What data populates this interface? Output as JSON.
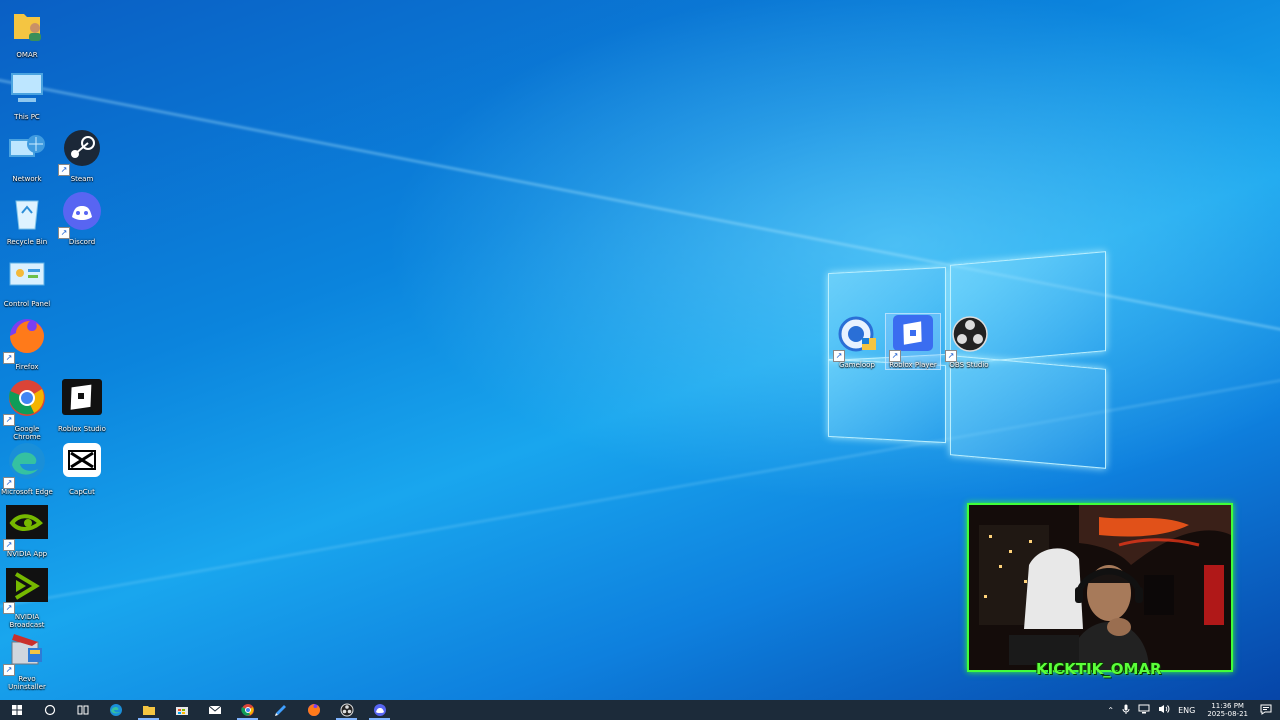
{
  "desktop_icons": [
    {
      "label": "OMAR",
      "icon": "user-folder-icon"
    },
    {
      "label": "This PC",
      "icon": "computer-icon"
    },
    {
      "label": "Network",
      "icon": "network-icon"
    },
    {
      "label": "Steam",
      "icon": "steam-icon"
    },
    {
      "label": "Recycle Bin",
      "icon": "recycle-bin-icon"
    },
    {
      "label": "Discord",
      "icon": "discord-icon"
    },
    {
      "label": "Control Panel",
      "icon": "control-panel-icon"
    },
    {
      "label": "Firefox",
      "icon": "firefox-icon"
    },
    {
      "label": "Google Chrome",
      "icon": "chrome-icon"
    },
    {
      "label": "Roblox Studio",
      "icon": "roblox-studio-icon"
    },
    {
      "label": "Microsoft Edge",
      "icon": "edge-icon"
    },
    {
      "label": "CapCut",
      "icon": "capcut-icon"
    },
    {
      "label": "NVIDIA App",
      "icon": "nvidia-icon"
    },
    {
      "label": "NVIDIA Broadcast",
      "icon": "nvidia-broadcast-icon"
    },
    {
      "label": "Revo Uninstaller",
      "icon": "revo-uninstaller-icon"
    },
    {
      "label": "Gameloop",
      "icon": "gameloop-icon"
    },
    {
      "label": "Roblox Player",
      "icon": "roblox-player-icon"
    },
    {
      "label": "OBS Studio",
      "icon": "obs-icon"
    }
  ],
  "overlay": {
    "text": "KICKTIK_OMAR"
  },
  "taskbar": {
    "apps": [
      "start-icon",
      "search-icon",
      "task-view-icon",
      "edge-icon",
      "file-explorer-icon",
      "store-icon",
      "mail-icon",
      "chrome-icon",
      "app-icon",
      "firefox-icon",
      "obs-icon",
      "discord-icon"
    ],
    "active": [
      "file-explorer-icon",
      "chrome-icon",
      "obs-icon",
      "discord-icon"
    ]
  },
  "tray": {
    "lang": "ENG",
    "time": "11:36 PM",
    "date": "2025-08-21"
  },
  "colors": {
    "accent_green": "#40ff3a",
    "taskbar": "#1c2b3a"
  }
}
